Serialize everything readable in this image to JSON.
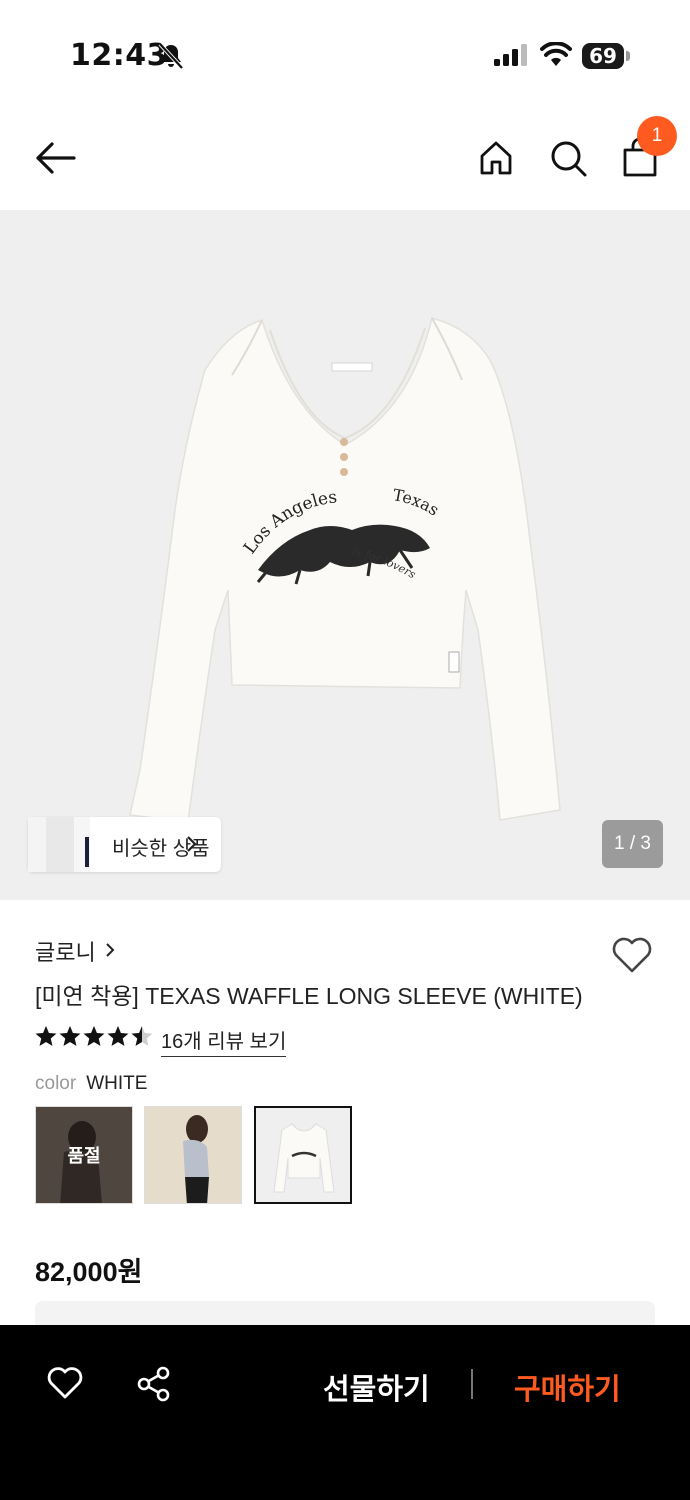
{
  "status_bar": {
    "time": "12:43",
    "battery": "69"
  },
  "header": {
    "cart_count": "1"
  },
  "image": {
    "similar_label": "비슷한 상품",
    "page_indicator": "1 / 3",
    "print_text_left": "Los Angeles",
    "print_text_right": "Texas",
    "print_text_sub": "is for lovers"
  },
  "product": {
    "brand": "글로니",
    "title": "[미연 착용] TEXAS WAFFLE LONG SLEEVE (WHITE)",
    "rating": 4.5,
    "review_link": "16개 리뷰 보기",
    "color_label": "color",
    "color_value": "WHITE",
    "swatches": [
      {
        "soldout": "품절"
      }
    ],
    "price": "82,000원"
  },
  "bottom": {
    "gift_label": "선물하기",
    "buy_label": "구매하기"
  },
  "colors": {
    "accent": "#ff5a1f",
    "image_bg": "#efefef",
    "bar_bg": "#000000"
  }
}
